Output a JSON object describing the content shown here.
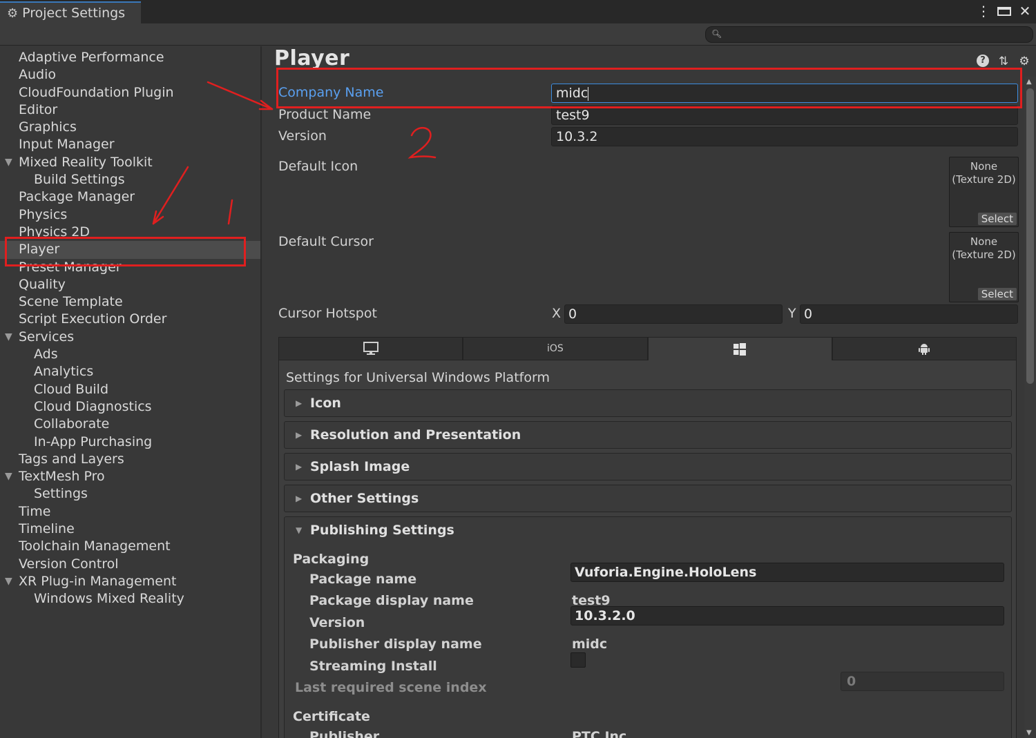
{
  "window": {
    "tab_title": "Project Settings",
    "icon": "gear-icon"
  },
  "search": {
    "placeholder": "",
    "icon": "search-icon"
  },
  "sidebar": {
    "items": [
      {
        "label": "Adaptive Performance",
        "level": 0
      },
      {
        "label": "Audio",
        "level": 0
      },
      {
        "label": "CloudFoundation Plugin",
        "level": 0
      },
      {
        "label": "Editor",
        "level": 0
      },
      {
        "label": "Graphics",
        "level": 0
      },
      {
        "label": "Input Manager",
        "level": 0
      },
      {
        "label": "Mixed Reality Toolkit",
        "level": 0,
        "expanded": true
      },
      {
        "label": "Build Settings",
        "level": 1
      },
      {
        "label": "Package Manager",
        "level": 0
      },
      {
        "label": "Physics",
        "level": 0
      },
      {
        "label": "Physics 2D",
        "level": 0
      },
      {
        "label": "Player",
        "level": 0,
        "selected": true
      },
      {
        "label": "Preset Manager",
        "level": 0
      },
      {
        "label": "Quality",
        "level": 0
      },
      {
        "label": "Scene Template",
        "level": 0
      },
      {
        "label": "Script Execution Order",
        "level": 0
      },
      {
        "label": "Services",
        "level": 0,
        "expanded": true
      },
      {
        "label": "Ads",
        "level": 1
      },
      {
        "label": "Analytics",
        "level": 1
      },
      {
        "label": "Cloud Build",
        "level": 1
      },
      {
        "label": "Cloud Diagnostics",
        "level": 1
      },
      {
        "label": "Collaborate",
        "level": 1
      },
      {
        "label": "In-App Purchasing",
        "level": 1
      },
      {
        "label": "Tags and Layers",
        "level": 0
      },
      {
        "label": "TextMesh Pro",
        "level": 0,
        "expanded": true
      },
      {
        "label": "Settings",
        "level": 1
      },
      {
        "label": "Time",
        "level": 0
      },
      {
        "label": "Timeline",
        "level": 0
      },
      {
        "label": "Toolchain Management",
        "level": 0
      },
      {
        "label": "Version Control",
        "level": 0
      },
      {
        "label": "XR Plug-in Management",
        "level": 0,
        "expanded": true
      },
      {
        "label": "Windows Mixed Reality",
        "level": 1
      }
    ]
  },
  "main": {
    "title": "Player",
    "company_name_label": "Company Name",
    "company_name_value": "midc",
    "product_name_label": "Product Name",
    "product_name_value": "test9",
    "version_label": "Version",
    "version_value": "10.3.2",
    "default_icon_label": "Default Icon",
    "default_cursor_label": "Default Cursor",
    "texture_none_line1": "None",
    "texture_none_line2": "(Texture 2D)",
    "texture_select": "Select",
    "cursor_hotspot_label": "Cursor Hotspot",
    "hotspot_x_label": "X",
    "hotspot_x_value": "0",
    "hotspot_y_label": "Y",
    "hotspot_y_value": "0"
  },
  "platform_tabs": [
    {
      "name": "desktop-icon",
      "label": ""
    },
    {
      "name": "ios",
      "label": "iOS"
    },
    {
      "name": "windows-icon",
      "label": "",
      "active": true
    },
    {
      "name": "android-icon",
      "label": ""
    }
  ],
  "platform": {
    "title": "Settings for Universal Windows Platform",
    "foldouts": [
      "Icon",
      "Resolution and Presentation",
      "Splash Image",
      "Other Settings"
    ],
    "publishing_title": "Publishing Settings",
    "packaging_header": "Packaging",
    "package_name_label": "Package name",
    "package_name_value": "Vuforia.Engine.HoloLens",
    "package_display_name_label": "Package display name",
    "package_display_name_value": "test9",
    "pkg_version_label": "Version",
    "pkg_version_value": "10.3.2.0",
    "publisher_display_name_label": "Publisher display name",
    "publisher_display_name_value": "midc",
    "streaming_install_label": "Streaming Install",
    "streaming_install_checked": false,
    "last_scene_index_label": "Last required scene index",
    "last_scene_index_value": "0",
    "certificate_header": "Certificate",
    "publisher_label": "Publisher",
    "publisher_value": "PTC Inc."
  },
  "annotations": {
    "color": "#e01f1f",
    "marks": [
      "1",
      "2"
    ]
  }
}
